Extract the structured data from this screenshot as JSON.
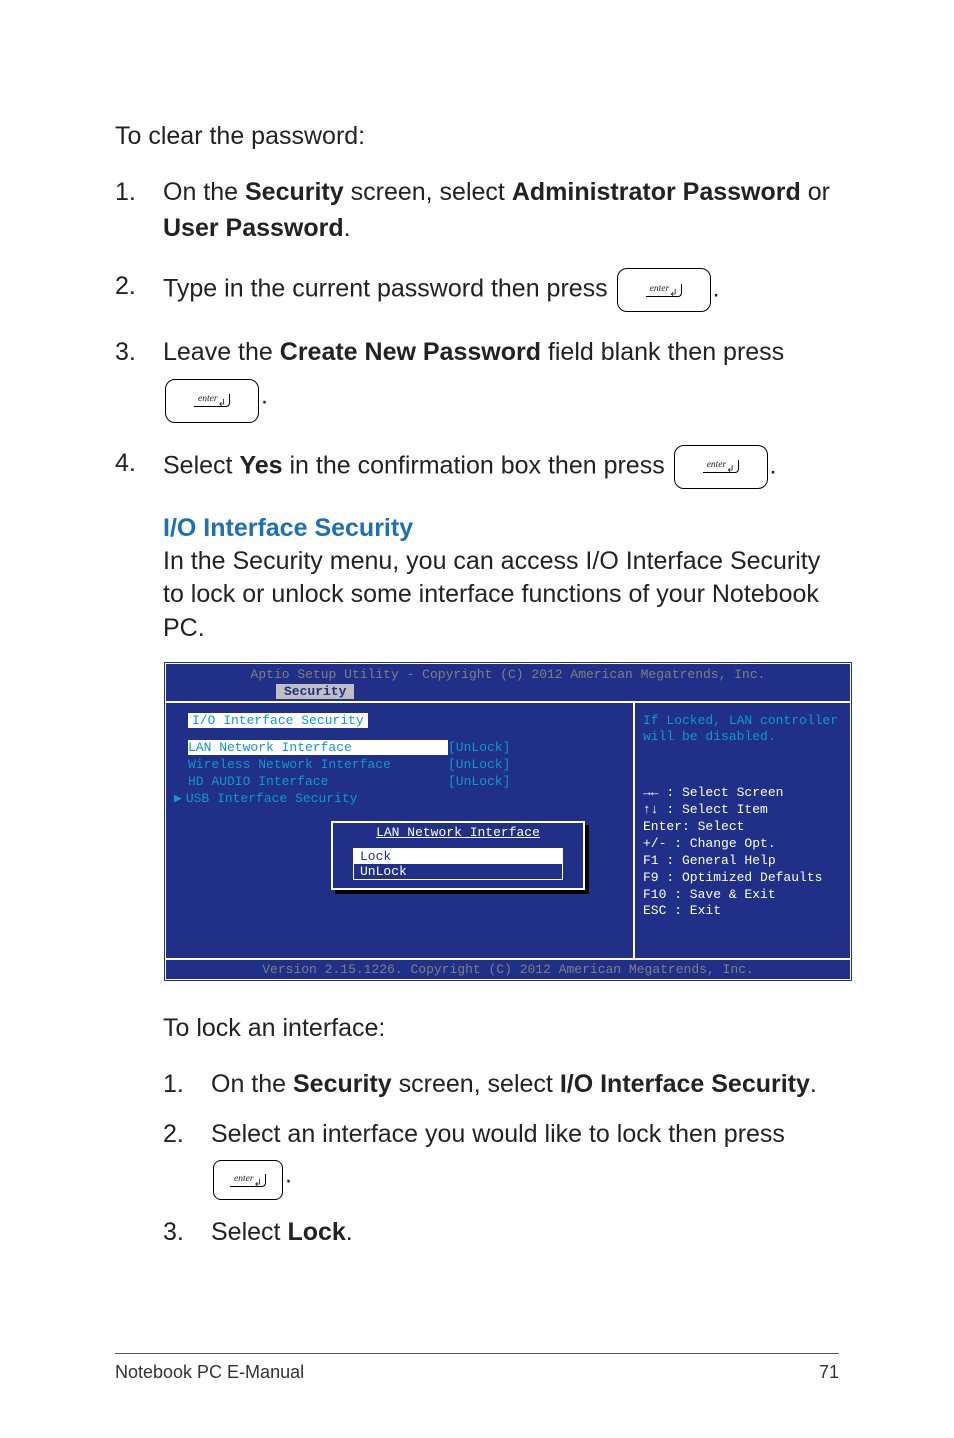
{
  "intro": "To clear the password:",
  "steps_clear": [
    {
      "pre": "On the ",
      "b1": "Security",
      "mid": " screen, select ",
      "b2": "Administrator Password",
      "mid2": " or ",
      "b3": "User Password",
      "post": "."
    },
    {
      "pre": "Type in the current password then press ",
      "key": "enter",
      "post": "."
    },
    {
      "pre": "Leave the ",
      "b1": "Create New Password",
      "mid": " field blank then press ",
      "key": "enter",
      "post": "."
    },
    {
      "pre": "Select ",
      "b1": "Yes",
      "mid": " in the confirmation box then press ",
      "key": "enter",
      "post": "."
    }
  ],
  "section_heading": "I/O Interface Security",
  "section_para": "In the Security menu, you can access I/O Interface Security to lock or unlock some interface functions of your Notebook PC.",
  "bios": {
    "header": "Aptio Setup Utility - Copyright (C) 2012 American Megatrends, Inc.",
    "tab": "Security",
    "panel_title": "I/O Interface Security",
    "rows": [
      {
        "label": "LAN Network Interface",
        "value": "[UnLock]",
        "selected": true
      },
      {
        "label": "Wireless Network Interface",
        "value": "[UnLock]",
        "selected": false
      },
      {
        "label": "HD AUDIO Interface",
        "value": "[UnLock]",
        "selected": false
      }
    ],
    "submenu": "USB Interface Security",
    "popup_title": "LAN Network Interface",
    "popup_options": [
      "Lock",
      "UnLock"
    ],
    "help_top": "If Locked, LAN controller will be disabled.",
    "help": {
      "arrows_h": "→← : Select Screen",
      "arrows_v": "↑↓  : Select Item",
      "enter": "Enter: Select",
      "pm": "+/- : Change Opt.",
      "f1": "F1  : General Help",
      "f9": "F9  : Optimized Defaults",
      "f10": "F10 : Save & Exit",
      "esc": "ESC : Exit"
    },
    "footer": "Version 2.15.1226. Copyright (C) 2012 American Megatrends, Inc."
  },
  "lock_intro": "To lock an interface:",
  "steps_lock": [
    {
      "pre": "On the ",
      "b1": "Security",
      "mid": " screen, select ",
      "b2": "I/O Interface Security",
      "post": "."
    },
    {
      "pre": "Select an interface you would like to lock then press ",
      "key": "enter",
      "post": "."
    },
    {
      "pre": "Select ",
      "b1": "Lock",
      "post": "."
    }
  ],
  "footer_left": "Notebook PC E-Manual",
  "footer_right": "71",
  "key_label": "enter"
}
